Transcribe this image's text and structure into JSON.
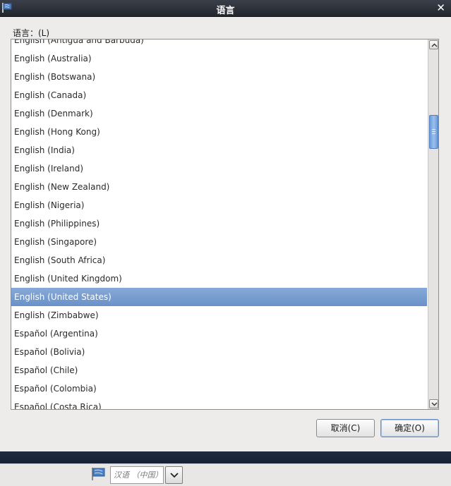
{
  "window": {
    "title": "语言",
    "close_glyph": "✕"
  },
  "language_label": "语言：(L)",
  "languages": [
    "English (Antigua and Barbuda)",
    "English (Australia)",
    "English (Botswana)",
    "English (Canada)",
    "English (Denmark)",
    "English (Hong Kong)",
    "English (India)",
    "English (Ireland)",
    "English (New Zealand)",
    "English (Nigeria)",
    "English (Philippines)",
    "English (Singapore)",
    "English (South Africa)",
    "English (United Kingdom)",
    "English (United States)",
    "English (Zimbabwe)",
    "Español (Argentina)",
    "Español (Bolivia)",
    "Español (Chile)",
    "Español (Colombia)",
    "Español (Costa Rica)"
  ],
  "selected_language": "English (United States)",
  "buttons": {
    "cancel": "取消(C)",
    "ok": "确定(O)"
  },
  "keyboard": {
    "current": "汉语 （中国）"
  },
  "icons": {
    "window": "flag-icon",
    "keyboard": "flag-icon",
    "dropdown": "chevron-down-icon"
  },
  "colors": {
    "selection": "#7a9fd1",
    "titlebar": "#2b2f36",
    "scroll_thumb": "#7aa6e0"
  }
}
